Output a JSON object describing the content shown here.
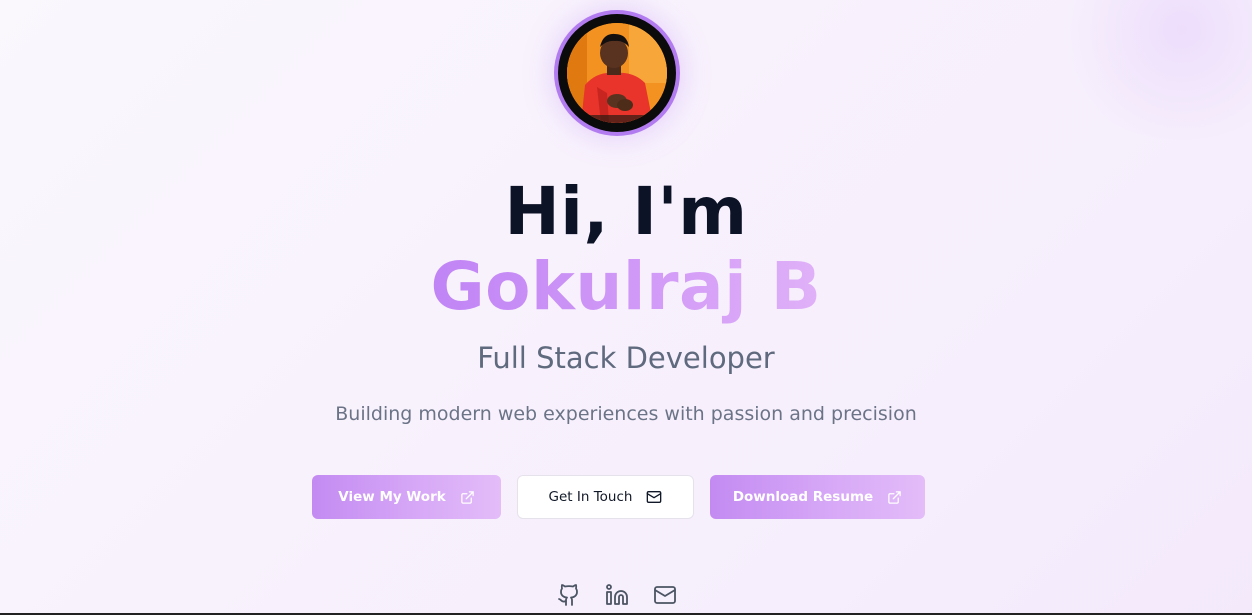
{
  "hero": {
    "greeting": "Hi, I'm",
    "name": "Gokulraj B",
    "role": "Full Stack Developer",
    "tagline": "Building modern web experiences with passion and precision",
    "avatar_icon": "profile-photo"
  },
  "buttons": {
    "view_work": {
      "label": "View My Work",
      "icon": "external-link-icon"
    },
    "get_in_touch": {
      "label": "Get In Touch",
      "icon": "mail-icon"
    },
    "download_resume": {
      "label": "Download Resume",
      "icon": "external-link-icon"
    }
  },
  "socials": [
    {
      "icon": "github-icon"
    },
    {
      "icon": "linkedin-icon"
    },
    {
      "icon": "mail-icon"
    }
  ],
  "colors": {
    "accent": "#c084f5",
    "heading": "#0d1326",
    "muted": "#5f6a7e",
    "avatar_ring": "#b27cf0"
  }
}
